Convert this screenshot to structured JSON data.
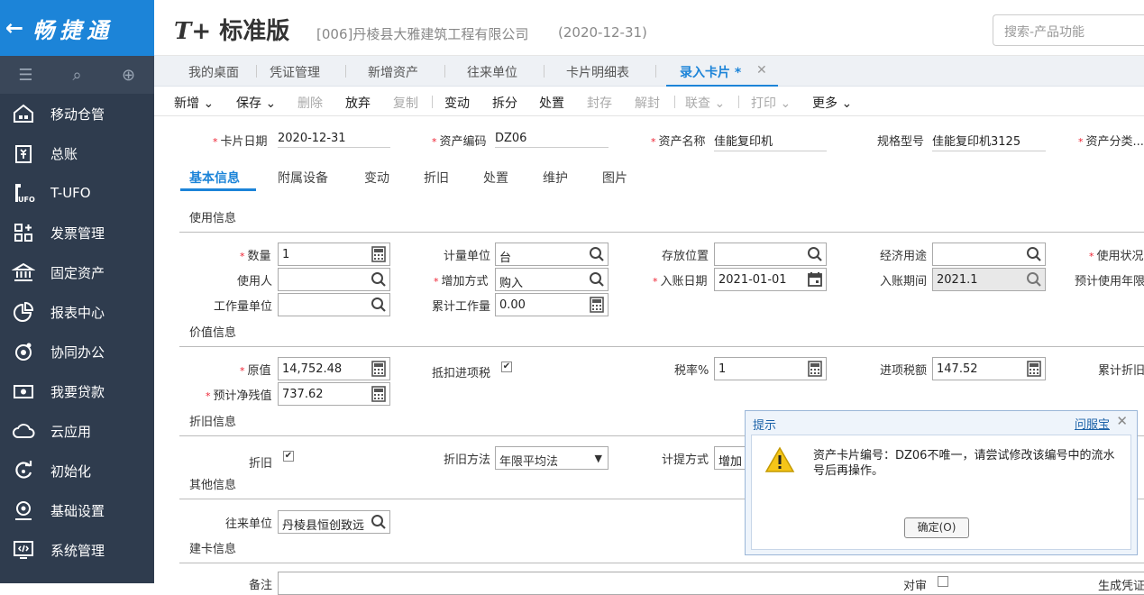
{
  "brand": {
    "arrow": "←",
    "name": "畅捷通"
  },
  "header": {
    "logo_t": "T+",
    "logo_text": "标准版",
    "company": "[006]丹棱县大雅建筑工程有限公司",
    "date": "(2020-12-31)",
    "search_placeholder": "搜索-产品功能"
  },
  "sidebar": {
    "items": [
      {
        "label": "移动仓管",
        "icon": "warehouse-icon"
      },
      {
        "label": "总账",
        "icon": "ledger-icon"
      },
      {
        "label": "T-UFO",
        "icon": "ufo-icon"
      },
      {
        "label": "发票管理",
        "icon": "invoice-icon"
      },
      {
        "label": "固定资产",
        "icon": "bank-icon"
      },
      {
        "label": "报表中心",
        "icon": "pie-chart-icon"
      },
      {
        "label": "协同办公",
        "icon": "collab-icon"
      },
      {
        "label": "我要贷款",
        "icon": "loan-icon"
      },
      {
        "label": "云应用",
        "icon": "cloud-icon"
      },
      {
        "label": "初始化",
        "icon": "refresh-icon"
      },
      {
        "label": "基础设置",
        "icon": "settings-icon"
      },
      {
        "label": "系统管理",
        "icon": "system-icon"
      }
    ]
  },
  "tabs": [
    {
      "label": "我的桌面"
    },
    {
      "label": "凭证管理"
    },
    {
      "label": "新增资产"
    },
    {
      "label": "往来单位"
    },
    {
      "label": "卡片明细表"
    },
    {
      "label": "录入卡片 *"
    }
  ],
  "toolbar": {
    "add": "新增",
    "save": "保存",
    "delete": "删除",
    "abandon": "放弃",
    "copy": "复制",
    "change": "变动",
    "split": "拆分",
    "dispose": "处置",
    "seal": "封存",
    "unseal": "解封",
    "query": "联查",
    "print": "打印",
    "more": "更多"
  },
  "top_fields": {
    "card_date_label": "卡片日期",
    "card_date": "2020-12-31",
    "asset_code_label": "资产编码",
    "asset_code": "DZ06",
    "asset_name_label": "资产名称",
    "asset_name": "佳能复印机",
    "spec_label": "规格型号",
    "spec": "佳能复印机3125",
    "category_label": "资产分类..."
  },
  "subtabs": [
    "基本信息",
    "附属设备",
    "变动",
    "折旧",
    "处置",
    "维护",
    "图片"
  ],
  "usage": {
    "section": "使用信息",
    "qty_label": "数量",
    "qty": "1",
    "unit_label": "计量单位",
    "unit": "台",
    "location_label": "存放位置",
    "location": "",
    "purpose_label": "经济用途",
    "purpose": "",
    "status_label": "使用状况",
    "user_label": "使用人",
    "user": "",
    "add_method_label": "增加方式",
    "add_method": "购入",
    "entry_date_label": "入账日期",
    "entry_date": "2021-01-01",
    "entry_period_label": "入账期间",
    "entry_period": "2021.1",
    "expected_life_label": "预计使用年限",
    "work_unit_label": "工作量单位",
    "work_unit": "",
    "accum_work_label": "累计工作量",
    "accum_work": "0.00"
  },
  "value": {
    "section": "价值信息",
    "original_label": "原值",
    "original": "14,752.48",
    "deduct_label": "抵扣进项税",
    "tax_rate_label": "税率%",
    "tax_rate": "1",
    "input_tax_label": "进项税额",
    "input_tax": "147.52",
    "accum_dep_label": "累计折旧",
    "residual_label": "预计净残值",
    "residual": "737.62"
  },
  "depreciation": {
    "section": "折旧信息",
    "dep_label": "折旧",
    "method_label": "折旧方法",
    "method": "年限平均法",
    "accrual_label": "计提方式",
    "accrual": "增加"
  },
  "other": {
    "section": "其他信息",
    "partner_label": "往来单位",
    "partner": "丹棱县恒创致远"
  },
  "build": {
    "section": "建卡信息",
    "remark_label": "备注",
    "bottom_mid": "对审",
    "bottom_right": "生成凭证"
  },
  "dialog": {
    "title": "提示",
    "help": "问服宝",
    "close": "✕",
    "message": "资产卡片编号：DZ06不唯一，请尝试修改该编号中的流水号后再操作。",
    "ok": "确定(O)"
  },
  "colors": {
    "brand": "#1c84d8",
    "sidebar": "#2f3c4e",
    "required": "#e23"
  }
}
